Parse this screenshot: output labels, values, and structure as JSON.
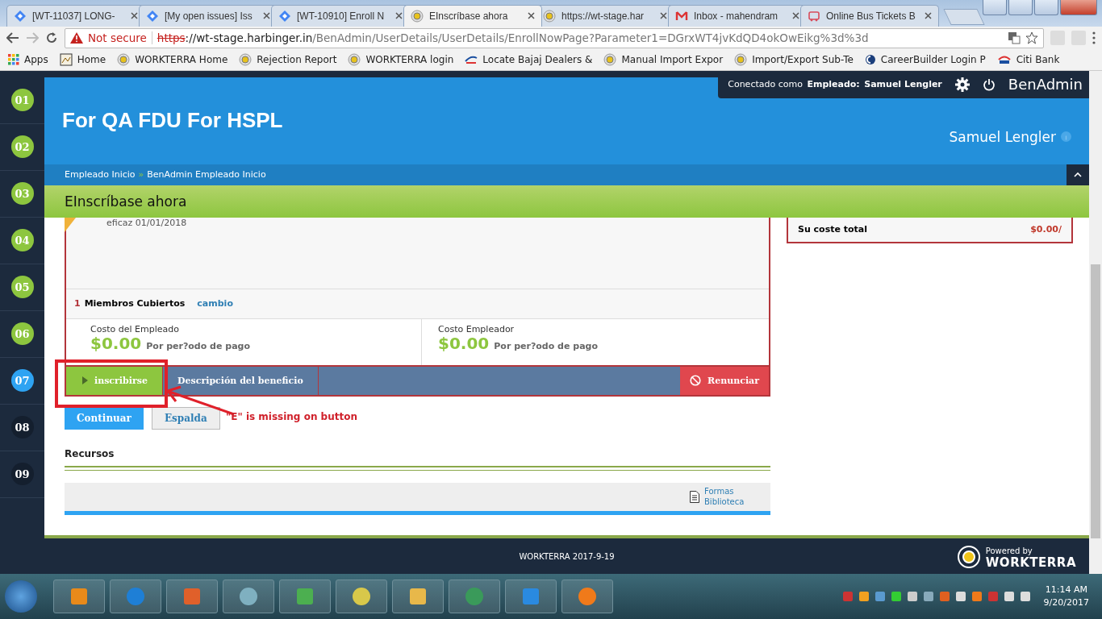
{
  "browser": {
    "tabs": [
      {
        "title": "[WT-11037] LONG-",
        "kind": "diamond",
        "selected": false
      },
      {
        "title": "[My open issues] Iss",
        "kind": "diamond",
        "selected": false
      },
      {
        "title": "[WT-10910] Enroll N",
        "kind": "diamond",
        "selected": false
      },
      {
        "title": "EInscríbase ahora",
        "kind": "badge",
        "selected": true
      },
      {
        "title": "https://wt-stage.har",
        "kind": "badge",
        "selected": false
      },
      {
        "title": "Inbox - mahendram",
        "kind": "mail",
        "selected": false
      },
      {
        "title": "Online Bus Tickets B",
        "kind": "bus",
        "selected": false
      }
    ],
    "address": {
      "warning": "Not secure",
      "scheme": "https",
      "host": "://wt-stage.harbinger.in",
      "path": "/BenAdmin/UserDetails/UserDetails/EnrollNowPage?Parameter1=DGrxWT4jvKdQD4okOwEikg%3d%3d"
    },
    "bookmarks": [
      {
        "label": "Apps",
        "kind": "grid"
      },
      {
        "label": "Home",
        "kind": "image"
      },
      {
        "label": "WORKTERRA Home",
        "kind": "badge"
      },
      {
        "label": "Rejection Report",
        "kind": "badge"
      },
      {
        "label": "WORKTERRA login",
        "kind": "badge"
      },
      {
        "label": "Locate Bajaj Dealers &",
        "kind": "swoosh"
      },
      {
        "label": "Manual Import Expor",
        "kind": "badge"
      },
      {
        "label": "Import/Export Sub-Te",
        "kind": "badge"
      },
      {
        "label": "CareerBuilder Login P",
        "kind": "circle"
      },
      {
        "label": "Citi  Bank",
        "kind": "citi"
      }
    ]
  },
  "steps": [
    {
      "label": "01",
      "kind": "done"
    },
    {
      "label": "02",
      "kind": "done"
    },
    {
      "label": "03",
      "kind": "done"
    },
    {
      "label": "04",
      "kind": "done"
    },
    {
      "label": "05",
      "kind": "done"
    },
    {
      "label": "06",
      "kind": "done"
    },
    {
      "label": "07",
      "kind": "current"
    },
    {
      "label": "08",
      "kind": "todo"
    },
    {
      "label": "09",
      "kind": "todo"
    }
  ],
  "header": {
    "session_prefix": "Conectado como",
    "session_role": "Empleado:",
    "session_user": "Samuel Lengler",
    "app_name": "BenAdmin",
    "title": "For QA FDU For HSPL",
    "user_name": "Samuel Lengler",
    "breadcrumbs": [
      "Empleado Inicio",
      "BenAdmin Empleado Inicio"
    ],
    "breadcrumb_separator": "»",
    "page_title": "EInscríbase ahora"
  },
  "plan": {
    "effective": "eficaz 01/01/2018",
    "members": {
      "count": "1",
      "label": "Miembros Cubiertos",
      "link": "cambio"
    },
    "costs": [
      {
        "label": "Costo del Empleado",
        "amount": "$0.00",
        "period": "Por per?odo de pago"
      },
      {
        "label": "Costo Empleador",
        "amount": "$0.00",
        "period": "Por per?odo de pago"
      }
    ],
    "actions": [
      {
        "label": "inscribirse",
        "selected": true
      },
      {
        "label": "Descripción del beneficio",
        "selected": false
      }
    ],
    "decline": "Renunciar"
  },
  "buttons": [
    "Continuar",
    "Espalda"
  ],
  "resources": {
    "title": "Recursos",
    "link": "Formas Biblioteca"
  },
  "summary": {
    "label": "Su coste total",
    "value": "$0.00/"
  },
  "footer": {
    "text": "WORKTERRA 2017-9-19",
    "powered_by": "Powered by",
    "brand": "WORKTERRA"
  },
  "annotation": {
    "text": "\"E\" is missing on button"
  },
  "taskbar": {
    "time": "11:14 AM",
    "date": "9/20/2017"
  }
}
